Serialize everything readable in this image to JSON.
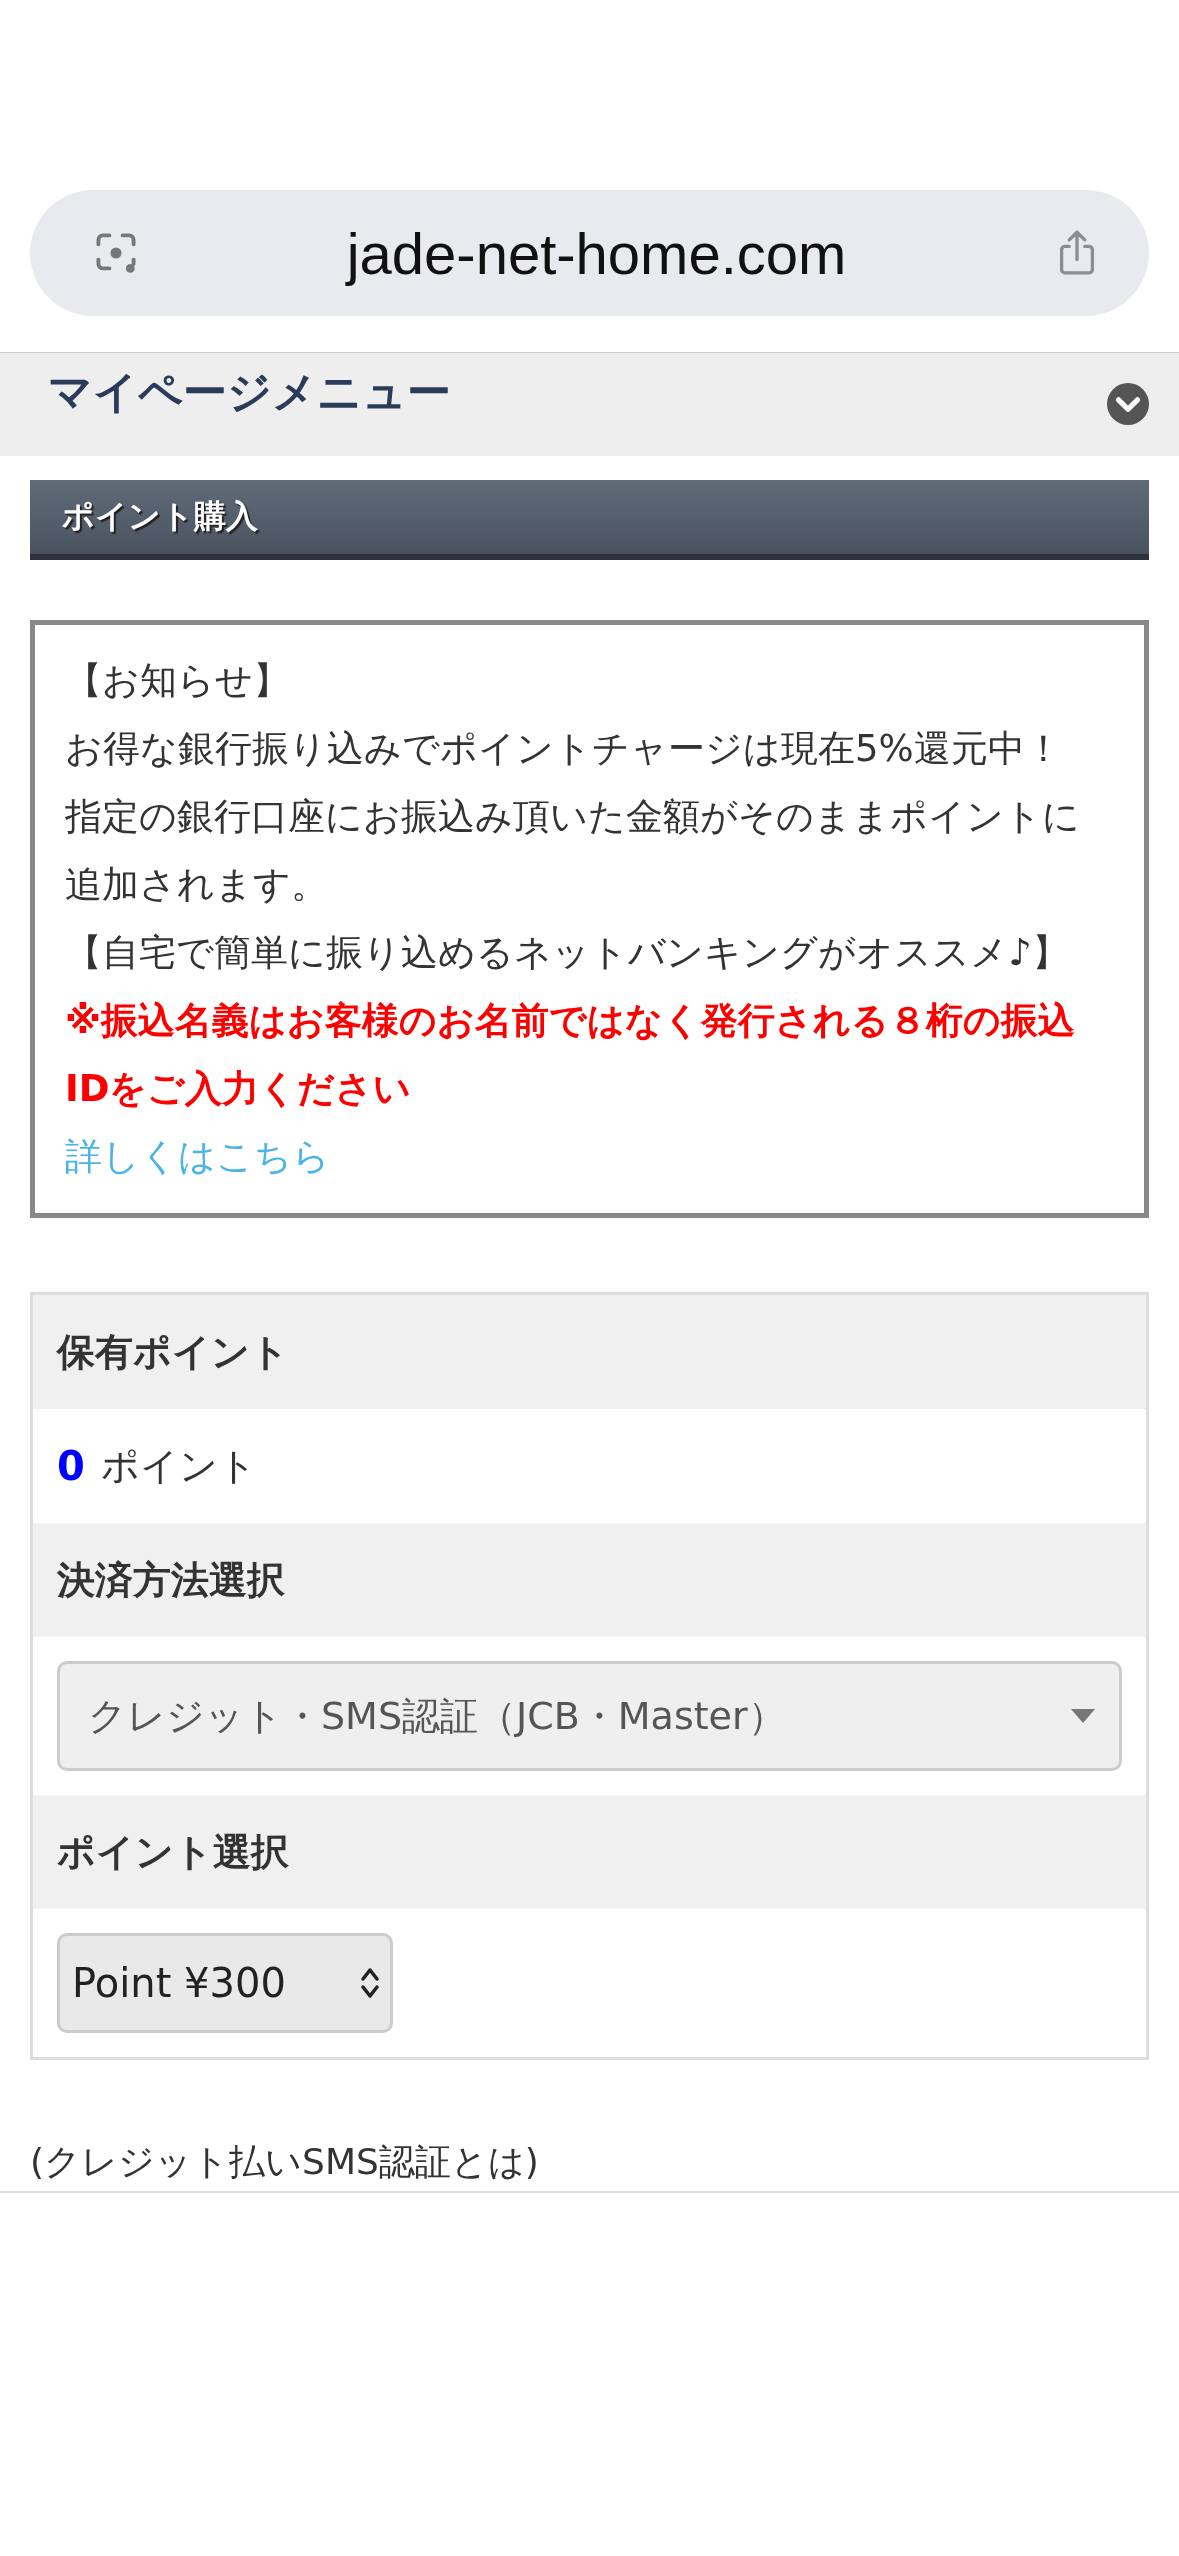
{
  "address_bar": {
    "url": "jade-net-home.com"
  },
  "menu": {
    "title": "マイページメニュー",
    "expanded": false
  },
  "section_title": "ポイント購入",
  "notice": {
    "paragraphs": [
      {
        "kind": "normal",
        "text": "【お知らせ】"
      },
      {
        "kind": "normal",
        "text": "お得な銀行振り込みでポイントチャージは現在5%還元中！"
      },
      {
        "kind": "normal",
        "text": "指定の銀行口座にお振込み頂いた金額がそのままポイントに追加されます。"
      },
      {
        "kind": "normal",
        "text": "【自宅で簡単に振り込めるネットバンキングがオススメ♪】"
      },
      {
        "kind": "warning",
        "text": "※振込名義はお客様のお名前ではなく発行される８桁の振込IDをご入力ください"
      },
      {
        "kind": "link",
        "text": "詳しくはこちら"
      }
    ]
  },
  "form": [
    {
      "kind": "points",
      "label": "保有ポイント",
      "value": "0",
      "unit": "ポイント"
    },
    {
      "kind": "dropdown",
      "label": "決済方法選択",
      "value": "クレジット・SMS認証（JCB・Master）"
    },
    {
      "kind": "stepper",
      "label": "ポイント選択",
      "value": "Point ¥300"
    }
  ],
  "footer_text": "(クレジット払いSMS認証とは)"
}
